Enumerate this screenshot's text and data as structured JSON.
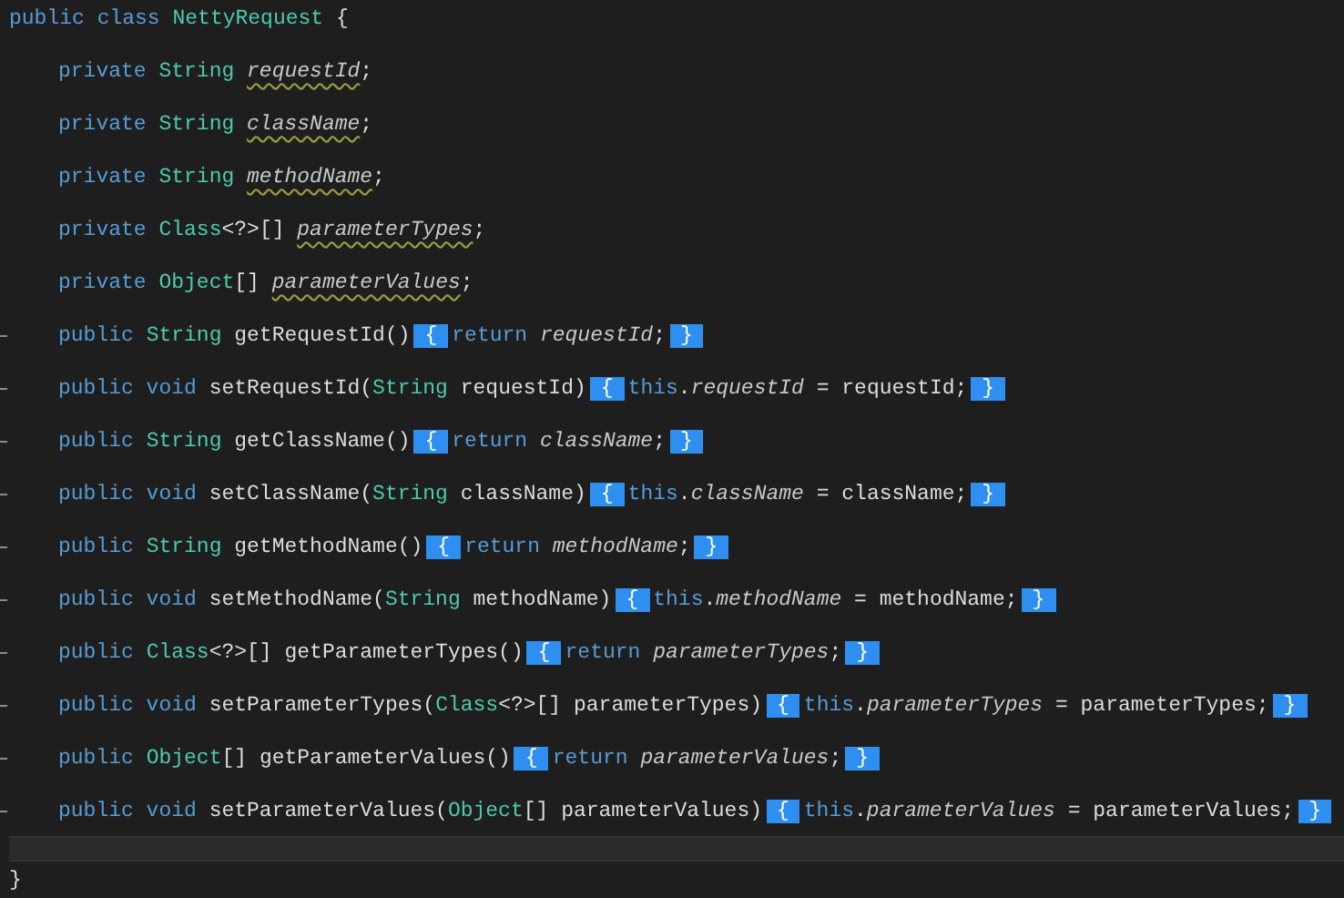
{
  "class_decl": [
    {
      "text": "public ",
      "kind": "keyword"
    },
    {
      "text": "class ",
      "kind": "keyword"
    },
    {
      "text": "NettyRequest",
      "kind": "type"
    },
    {
      "text": " {",
      "kind": "plain"
    }
  ],
  "members": [
    {
      "fold": false,
      "tokens": [
        {
          "text": "private ",
          "kind": "keyword"
        },
        {
          "text": "String ",
          "kind": "type"
        },
        {
          "text": "requestId",
          "kind": "field",
          "squiggle": true
        },
        {
          "text": ";",
          "kind": "plain"
        }
      ]
    },
    {
      "fold": false,
      "tokens": [
        {
          "text": "private ",
          "kind": "keyword"
        },
        {
          "text": "String ",
          "kind": "type"
        },
        {
          "text": "className",
          "kind": "field",
          "squiggle": true
        },
        {
          "text": ";",
          "kind": "plain"
        }
      ]
    },
    {
      "fold": false,
      "tokens": [
        {
          "text": "private ",
          "kind": "keyword"
        },
        {
          "text": "String ",
          "kind": "type"
        },
        {
          "text": "methodName",
          "kind": "field",
          "squiggle": true
        },
        {
          "text": ";",
          "kind": "plain"
        }
      ]
    },
    {
      "fold": false,
      "tokens": [
        {
          "text": "private ",
          "kind": "keyword"
        },
        {
          "text": "Class",
          "kind": "type"
        },
        {
          "text": "<?>[] ",
          "kind": "plain"
        },
        {
          "text": "parameterTypes",
          "kind": "field",
          "squiggle": true
        },
        {
          "text": ";",
          "kind": "plain"
        }
      ]
    },
    {
      "fold": false,
      "tokens": [
        {
          "text": "private ",
          "kind": "keyword"
        },
        {
          "text": "Object",
          "kind": "type"
        },
        {
          "text": "[] ",
          "kind": "plain"
        },
        {
          "text": "parameterValues",
          "kind": "field",
          "squiggle": true
        },
        {
          "text": ";",
          "kind": "plain"
        }
      ]
    },
    {
      "fold": true,
      "tokens": [
        {
          "text": "public ",
          "kind": "keyword"
        },
        {
          "text": "String ",
          "kind": "type"
        },
        {
          "text": "getRequestId()",
          "kind": "plain"
        },
        {
          "text": "{",
          "kind": "collapsed"
        },
        {
          "text": "return ",
          "kind": "keyword"
        },
        {
          "text": "requestId",
          "kind": "field"
        },
        {
          "text": ";",
          "kind": "plain"
        },
        {
          "text": "}",
          "kind": "collapsed"
        }
      ]
    },
    {
      "fold": true,
      "tokens": [
        {
          "text": "public void ",
          "kind": "keyword"
        },
        {
          "text": "setRequestId(",
          "kind": "plain"
        },
        {
          "text": "String",
          "kind": "type"
        },
        {
          "text": " requestId)",
          "kind": "plain"
        },
        {
          "text": "{",
          "kind": "collapsed"
        },
        {
          "text": "this",
          "kind": "keyword"
        },
        {
          "text": ".",
          "kind": "plain"
        },
        {
          "text": "requestId",
          "kind": "field"
        },
        {
          "text": " = requestId;",
          "kind": "plain"
        },
        {
          "text": "}",
          "kind": "collapsed"
        }
      ]
    },
    {
      "fold": true,
      "tokens": [
        {
          "text": "public ",
          "kind": "keyword"
        },
        {
          "text": "String ",
          "kind": "type"
        },
        {
          "text": "getClassName()",
          "kind": "plain"
        },
        {
          "text": "{",
          "kind": "collapsed"
        },
        {
          "text": "return ",
          "kind": "keyword"
        },
        {
          "text": "className",
          "kind": "field"
        },
        {
          "text": ";",
          "kind": "plain"
        },
        {
          "text": "}",
          "kind": "collapsed"
        }
      ]
    },
    {
      "fold": true,
      "tokens": [
        {
          "text": "public void ",
          "kind": "keyword"
        },
        {
          "text": "setClassName(",
          "kind": "plain"
        },
        {
          "text": "String",
          "kind": "type"
        },
        {
          "text": " className)",
          "kind": "plain"
        },
        {
          "text": "{",
          "kind": "collapsed"
        },
        {
          "text": "this",
          "kind": "keyword"
        },
        {
          "text": ".",
          "kind": "plain"
        },
        {
          "text": "className",
          "kind": "field"
        },
        {
          "text": " = className;",
          "kind": "plain"
        },
        {
          "text": "}",
          "kind": "collapsed"
        }
      ]
    },
    {
      "fold": true,
      "tokens": [
        {
          "text": "public ",
          "kind": "keyword"
        },
        {
          "text": "String ",
          "kind": "type"
        },
        {
          "text": "getMethodName()",
          "kind": "plain"
        },
        {
          "text": "{",
          "kind": "collapsed"
        },
        {
          "text": "return ",
          "kind": "keyword"
        },
        {
          "text": "methodName",
          "kind": "field"
        },
        {
          "text": ";",
          "kind": "plain"
        },
        {
          "text": "}",
          "kind": "collapsed"
        }
      ]
    },
    {
      "fold": true,
      "tokens": [
        {
          "text": "public void ",
          "kind": "keyword"
        },
        {
          "text": "setMethodName(",
          "kind": "plain"
        },
        {
          "text": "String",
          "kind": "type"
        },
        {
          "text": " methodName)",
          "kind": "plain"
        },
        {
          "text": "{",
          "kind": "collapsed"
        },
        {
          "text": "this",
          "kind": "keyword"
        },
        {
          "text": ".",
          "kind": "plain"
        },
        {
          "text": "methodName",
          "kind": "field"
        },
        {
          "text": " = methodName;",
          "kind": "plain"
        },
        {
          "text": "}",
          "kind": "collapsed"
        }
      ]
    },
    {
      "fold": true,
      "tokens": [
        {
          "text": "public ",
          "kind": "keyword"
        },
        {
          "text": "Class",
          "kind": "type"
        },
        {
          "text": "<?>[] getParameterTypes()",
          "kind": "plain"
        },
        {
          "text": "{",
          "kind": "collapsed"
        },
        {
          "text": "return ",
          "kind": "keyword"
        },
        {
          "text": "parameterTypes",
          "kind": "field"
        },
        {
          "text": ";",
          "kind": "plain"
        },
        {
          "text": "}",
          "kind": "collapsed"
        }
      ]
    },
    {
      "fold": true,
      "tokens": [
        {
          "text": "public void ",
          "kind": "keyword"
        },
        {
          "text": "setParameterTypes(",
          "kind": "plain"
        },
        {
          "text": "Class",
          "kind": "type"
        },
        {
          "text": "<?>[] parameterTypes)",
          "kind": "plain"
        },
        {
          "text": "{",
          "kind": "collapsed"
        },
        {
          "text": "this",
          "kind": "keyword"
        },
        {
          "text": ".",
          "kind": "plain"
        },
        {
          "text": "parameterTypes",
          "kind": "field"
        },
        {
          "text": " = parameterTypes;",
          "kind": "plain"
        },
        {
          "text": "}",
          "kind": "collapsed"
        }
      ]
    },
    {
      "fold": true,
      "tokens": [
        {
          "text": "public ",
          "kind": "keyword"
        },
        {
          "text": "Object",
          "kind": "type"
        },
        {
          "text": "[] getParameterValues()",
          "kind": "plain"
        },
        {
          "text": "{",
          "kind": "collapsed"
        },
        {
          "text": "return ",
          "kind": "keyword"
        },
        {
          "text": "parameterValues",
          "kind": "field"
        },
        {
          "text": ";",
          "kind": "plain"
        },
        {
          "text": "}",
          "kind": "collapsed"
        }
      ]
    },
    {
      "fold": true,
      "tokens": [
        {
          "text": "public void ",
          "kind": "keyword"
        },
        {
          "text": "setParameterValues(",
          "kind": "plain"
        },
        {
          "text": "Object",
          "kind": "type"
        },
        {
          "text": "[] parameterValues)",
          "kind": "plain"
        },
        {
          "text": "{",
          "kind": "collapsed"
        },
        {
          "text": "this",
          "kind": "keyword"
        },
        {
          "text": ".",
          "kind": "plain"
        },
        {
          "text": "parameterValues",
          "kind": "field"
        },
        {
          "text": " = parameterValues;",
          "kind": "plain"
        },
        {
          "text": "}",
          "kind": "collapsed"
        }
      ]
    }
  ],
  "blank_line": {
    "current": true
  },
  "closing": [
    {
      "text": "}",
      "kind": "plain"
    }
  ]
}
